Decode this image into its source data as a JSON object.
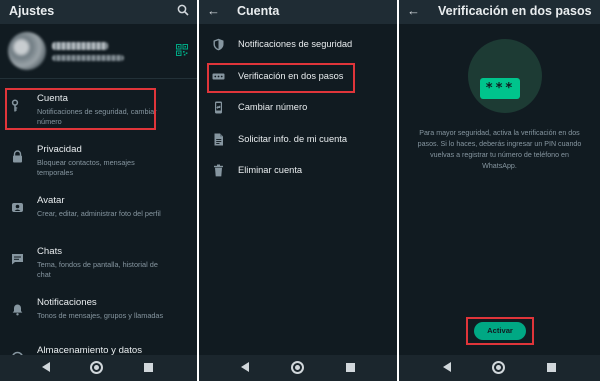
{
  "panels": [
    {
      "title": "Ajustes",
      "items": [
        {
          "label": "Cuenta",
          "subtitle": "Notificaciones de seguridad, cambiar número"
        },
        {
          "label": "Privacidad",
          "subtitle": "Bloquear contactos, mensajes temporales"
        },
        {
          "label": "Avatar",
          "subtitle": "Crear, editar, administrar foto del perfil"
        },
        {
          "label": "Chats",
          "subtitle": "Tema, fondos de pantalla, historial de chat"
        },
        {
          "label": "Notificaciones",
          "subtitle": "Tonos de mensajes, grupos y llamadas"
        },
        {
          "label": "Almacenamiento y datos",
          "subtitle": ""
        }
      ]
    },
    {
      "title": "Cuenta",
      "items": [
        {
          "label": "Notificaciones de seguridad"
        },
        {
          "label": "Verificación en dos pasos"
        },
        {
          "label": "Cambiar número"
        },
        {
          "label": "Solicitar info. de mi cuenta"
        },
        {
          "label": "Eliminar cuenta"
        }
      ]
    },
    {
      "title": "Verificación en dos pasos",
      "pin_placeholder": "***",
      "description": "Para mayor seguridad, activa la verificación en dos pasos. Si lo haces, deberás ingresar un PIN cuando vuelvas a registrar tu número de teléfono en WhatsApp.",
      "button_label": "Activar"
    }
  ],
  "colors": {
    "background": "#111b21",
    "topbar": "#1f2c34",
    "accent": "#00a884",
    "highlight": "#e0353a"
  }
}
